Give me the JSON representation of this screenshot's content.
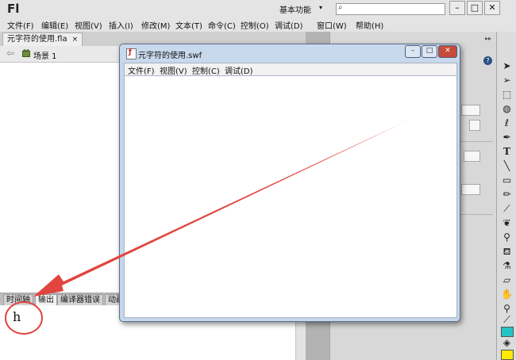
{
  "app": {
    "logo": "Fl",
    "workspace": "基本功能",
    "search_placeholder": ""
  },
  "window_controls": {
    "minimize": "–",
    "maximize": "□",
    "close": "✕"
  },
  "menubar": [
    "文件(F)",
    "编辑(E)",
    "视图(V)",
    "插入(I)",
    "修改(M)",
    "文本(T)",
    "命令(C)",
    "控制(O)",
    "调试(D)",
    "窗口(W)",
    "帮助(H)"
  ],
  "document": {
    "tab_title": "元字符的使用.fla",
    "tab_close": "×",
    "scene_label": "场景 1"
  },
  "bottom_panel": {
    "tabs": [
      "时间轴",
      "输出",
      "编译器错误",
      "动画"
    ],
    "active_tab": "输出",
    "output_text": "h"
  },
  "swf_player": {
    "title": "元字符的使用.swf",
    "menus": [
      "文件(F)",
      "视图(V)",
      "控制(C)",
      "调试(D)"
    ]
  },
  "tools": [
    "selection-tool",
    "subselection-tool",
    "free-transform-tool",
    "3d-rotation-tool",
    "lasso-tool",
    "pen-tool",
    "text-tool",
    "line-tool",
    "rectangle-tool",
    "pencil-tool",
    "brush-tool",
    "deco-tool",
    "bone-tool",
    "paint-bucket-tool",
    "eyedropper-tool",
    "eraser-tool",
    "hand-tool",
    "zoom-tool",
    "stroke-color-tool",
    "fill-color-tool"
  ],
  "colors": {
    "annotation": "#e0453f",
    "stroke_swatch": "#23c4c4",
    "fill_swatch": "#ffea00"
  }
}
